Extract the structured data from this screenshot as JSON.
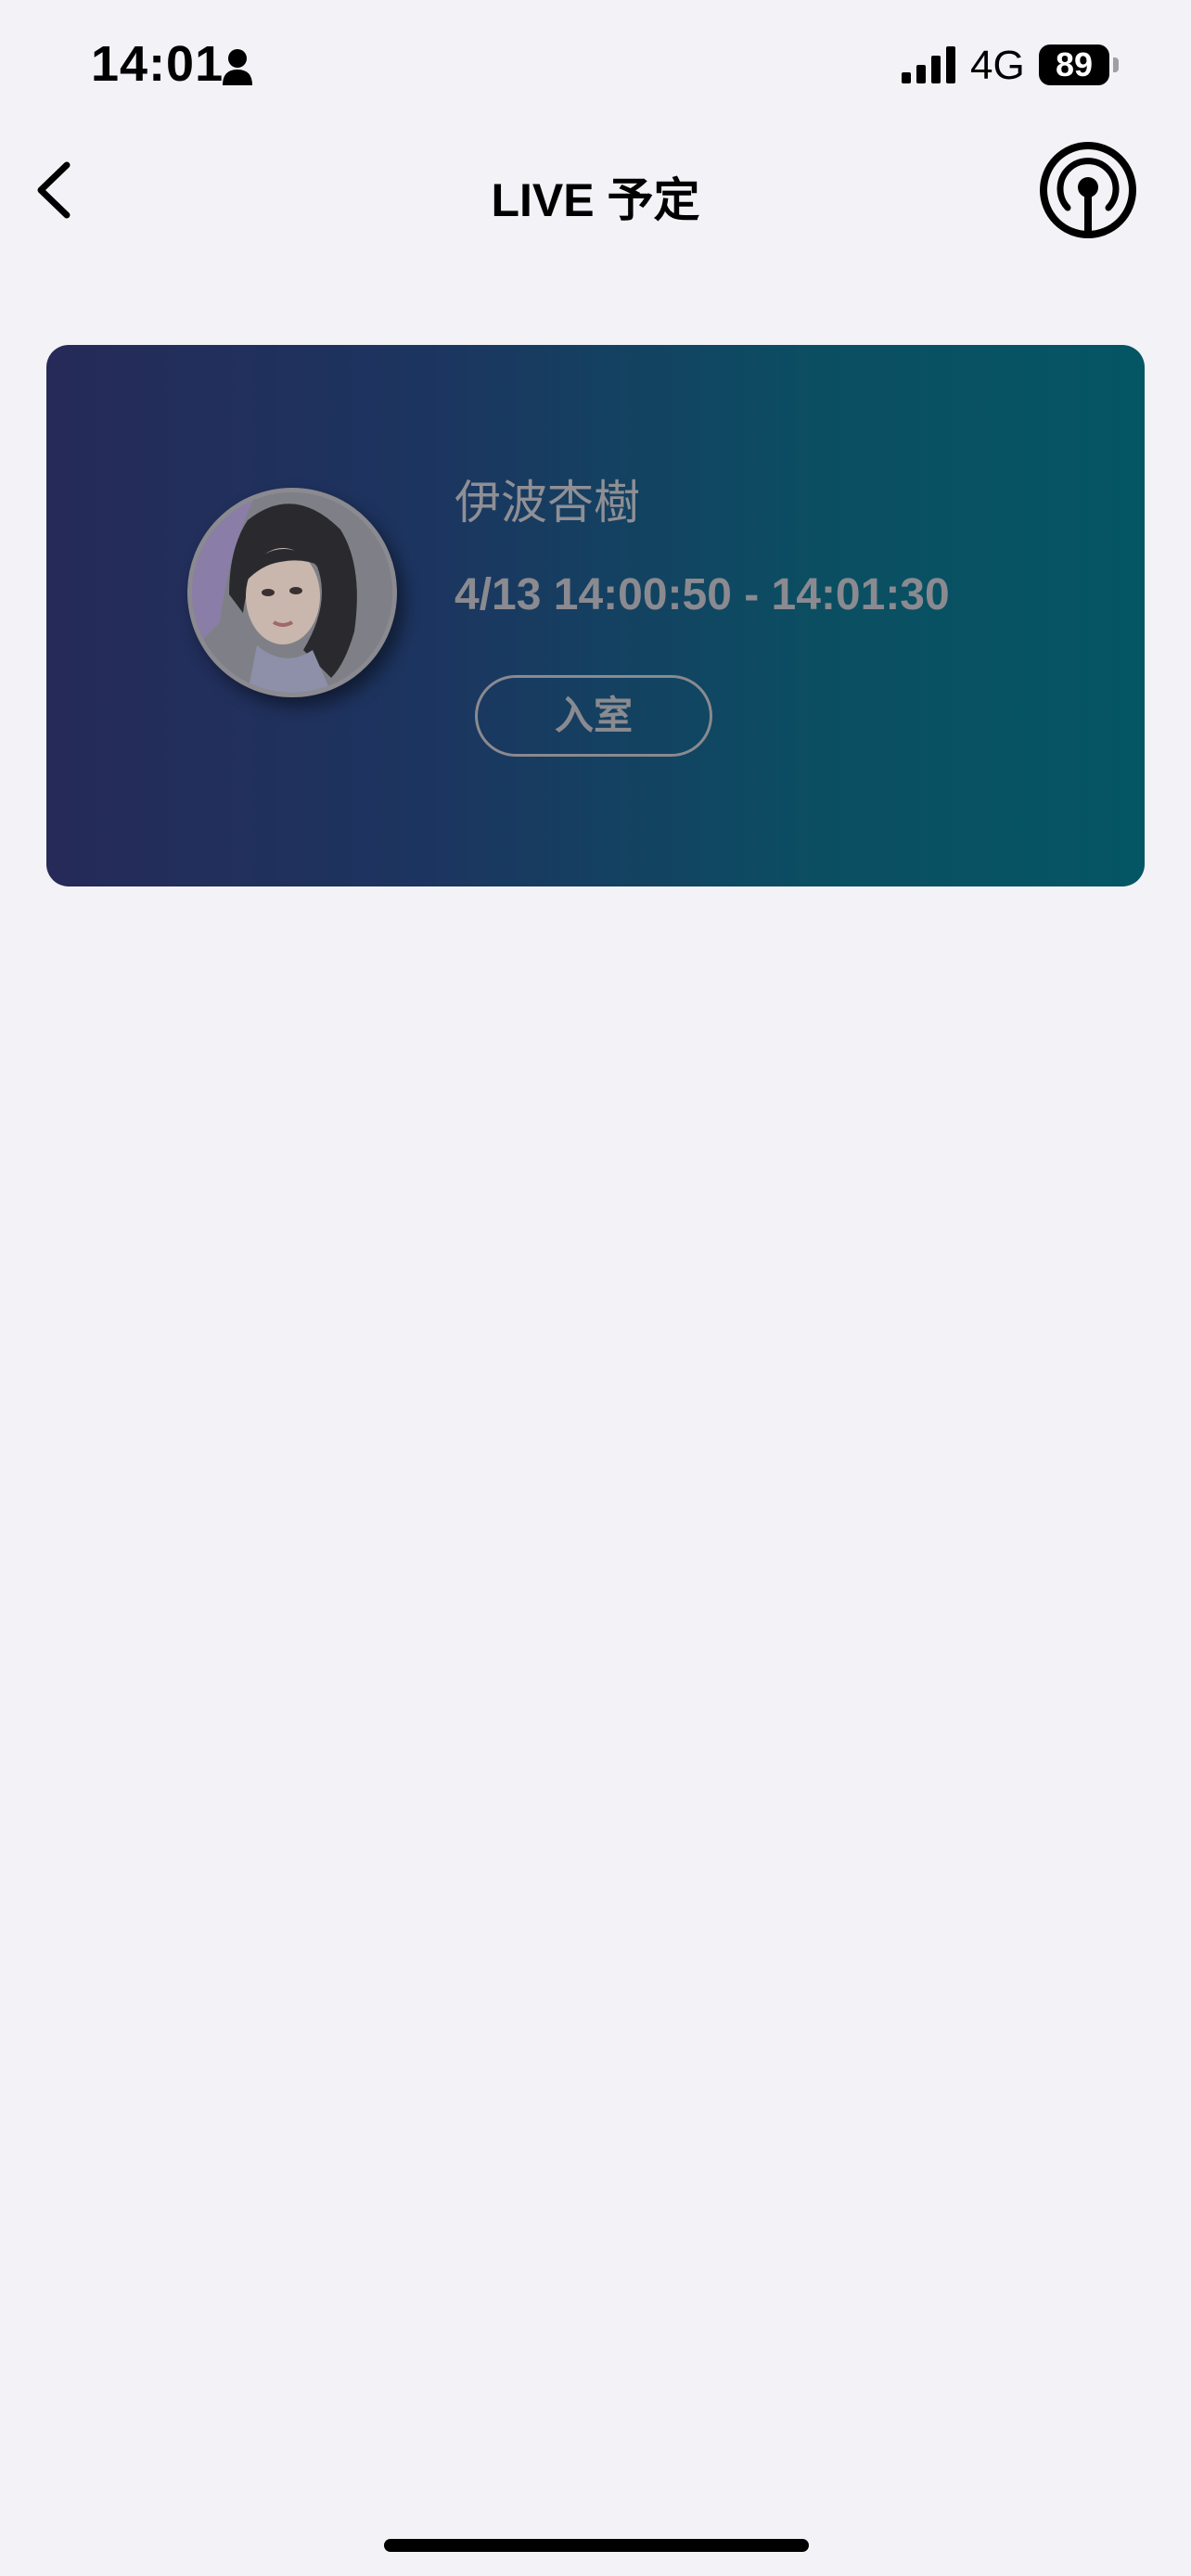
{
  "status_bar": {
    "time": "14:01",
    "network": "4G",
    "battery": "89"
  },
  "nav": {
    "title": "LIVE 予定"
  },
  "live_card": {
    "performer_name": "伊波杏樹",
    "time_range": "4/13 14:00:50 - 14:01:30",
    "enter_label": "入室"
  }
}
